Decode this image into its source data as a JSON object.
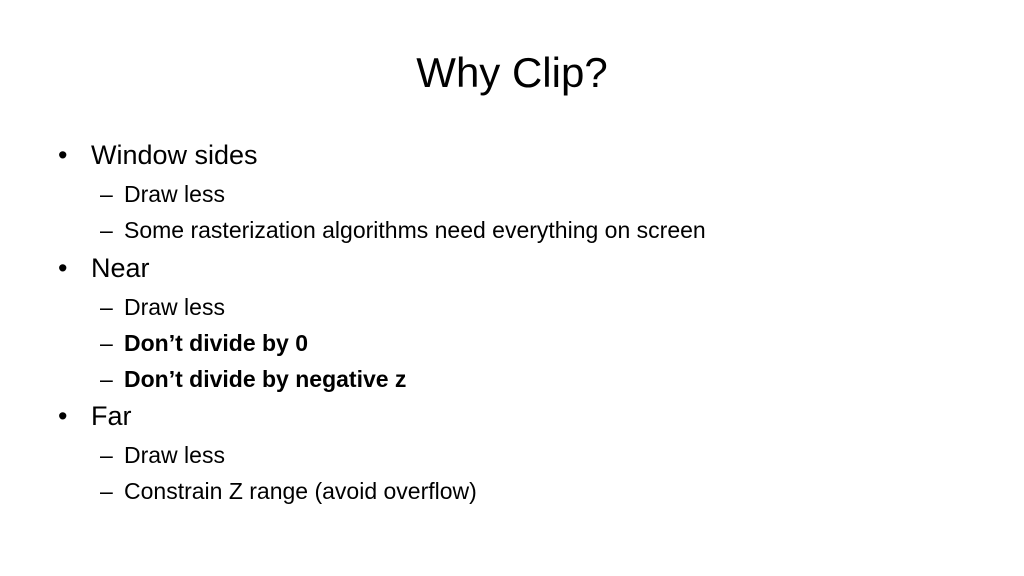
{
  "slide": {
    "title": "Why Clip?",
    "bullet_glyph": "•",
    "dash_glyph": "–",
    "items": [
      {
        "text": "Window sides",
        "sub": [
          {
            "text": "Draw less",
            "bold": false
          },
          {
            "text": "Some rasterization algorithms need everything on screen",
            "bold": false
          }
        ]
      },
      {
        "text": "Near",
        "sub": [
          {
            "text": "Draw less",
            "bold": false
          },
          {
            "text": "Don’t divide by 0",
            "bold": true
          },
          {
            "text": "Don’t divide by negative z",
            "bold": true
          }
        ]
      },
      {
        "text": "Far",
        "sub": [
          {
            "text": "Draw less",
            "bold": false
          },
          {
            "text": "Constrain Z range (avoid overflow)",
            "bold": false
          }
        ]
      }
    ]
  }
}
